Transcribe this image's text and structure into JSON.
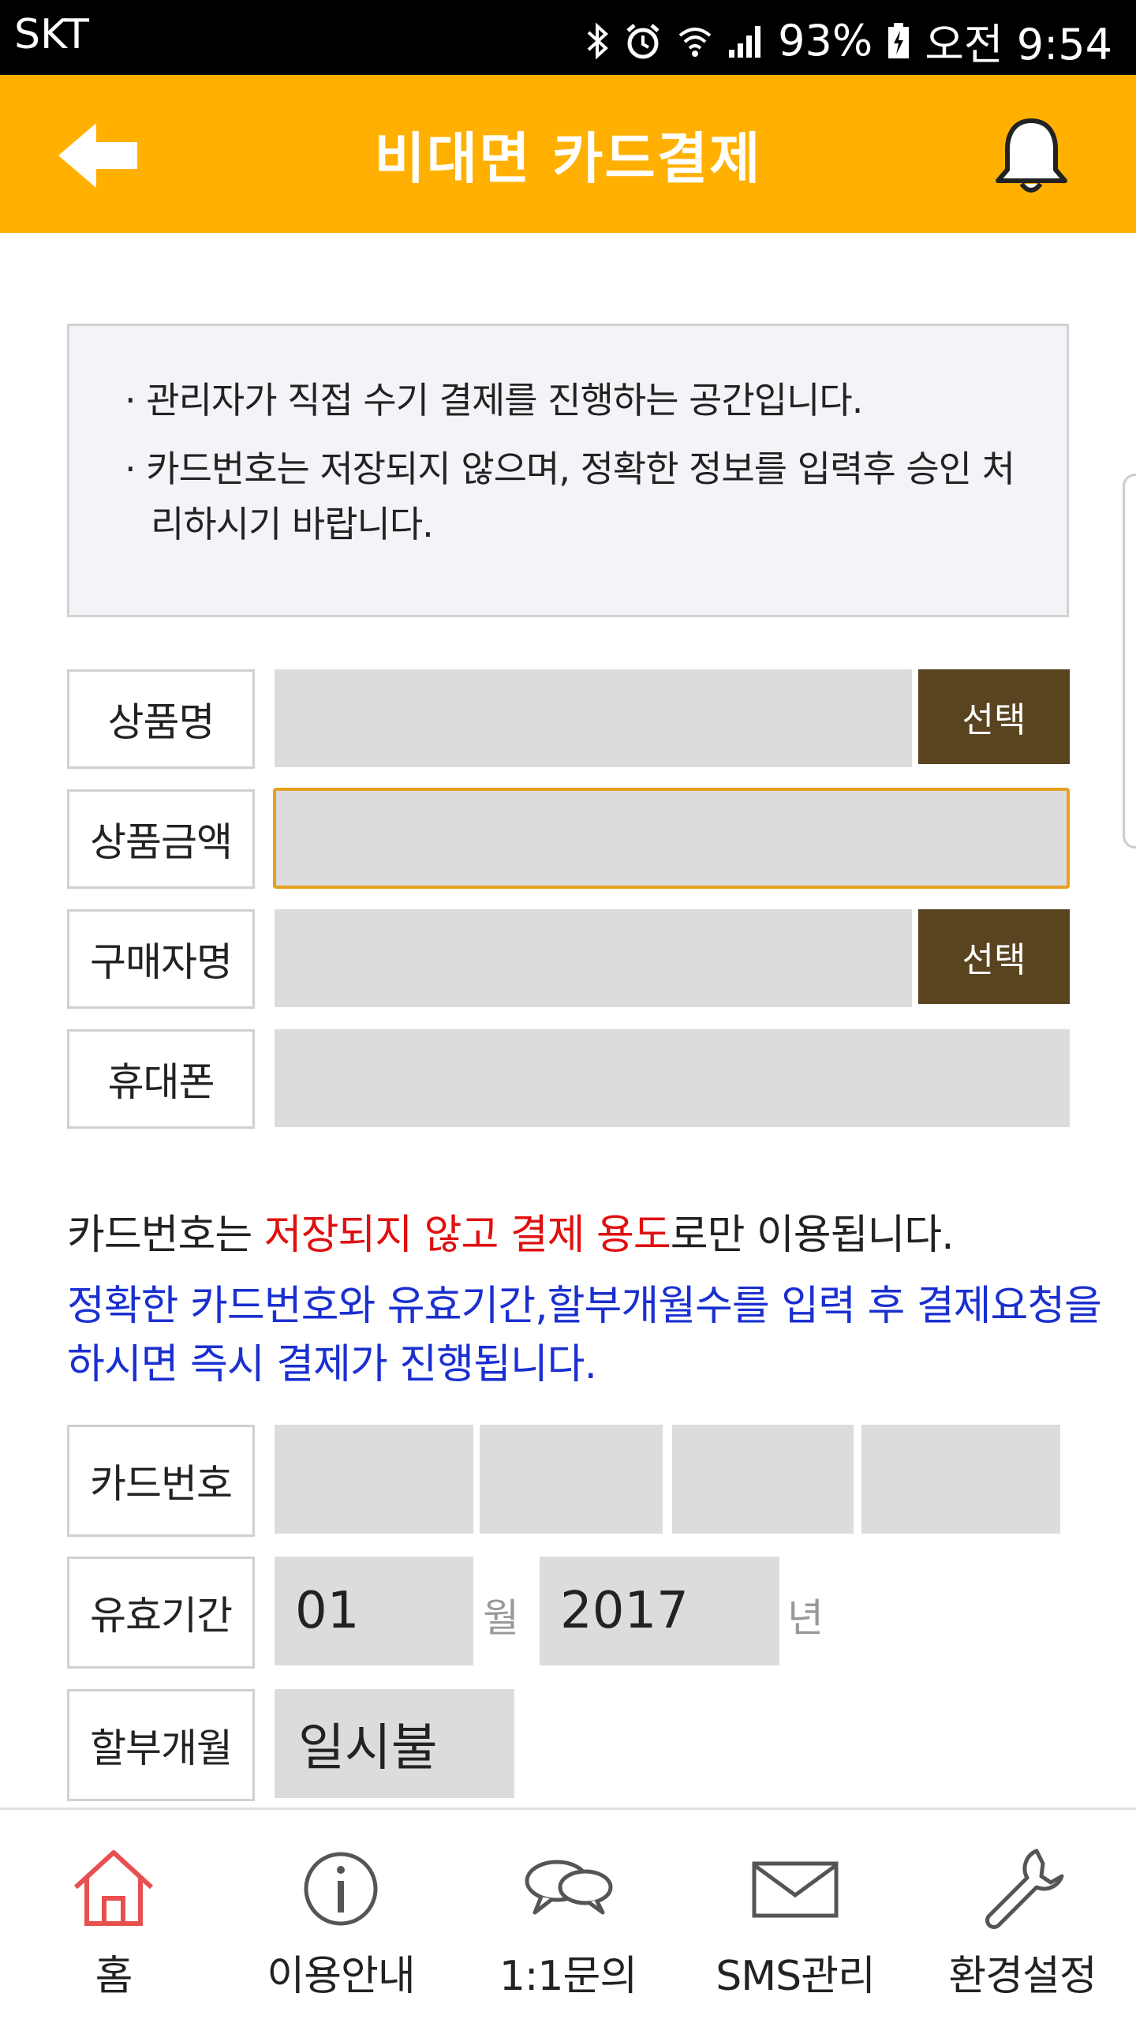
{
  "status_bar": {
    "carrier": "SKT",
    "battery": "93%",
    "time": "오전 9:54"
  },
  "header": {
    "title": "비대면 카드결제",
    "back_icon": "arrow-left-icon",
    "bell_icon": "bell-icon",
    "color": "#ffb000"
  },
  "notice": {
    "line1": "· 관리자가 직접 수기 결제를 진행하는 공간입니다.",
    "line2": "· 카드번호는 저장되지 않으며, 정확한 정보를 입력후 승인 처",
    "line3": "리하시기 바랍니다."
  },
  "form": {
    "product_name_label": "상품명",
    "product_name_value": "",
    "product_price_label": "상품금액",
    "product_price_value": "",
    "buyer_name_label": "구매자명",
    "buyer_name_value": "",
    "phone_label": "휴대폰",
    "phone_value": "",
    "select_label": "선택",
    "select_color": "#5a4420"
  },
  "card_info": {
    "line1_prefix": "카드번호는 ",
    "line1_highlight": "저장되지 않고 결제 용도",
    "line1_suffix": "로만 이용됩니다.",
    "line2": "정확한 카드번호와 유효기간,할부개월수를 입력 후 결제요청을",
    "line3": "하시면 즉시 결제가 진행됩니다.",
    "highlight_color": "#e01010",
    "blue_color": "#1a2fd0"
  },
  "card_form": {
    "card_number_label": "카드번호",
    "card_number_parts": [
      "",
      "",
      "",
      ""
    ],
    "expiry_label": "유효기간",
    "expiry_month": "01",
    "month_unit": "월",
    "expiry_year": "2017",
    "year_unit": "년",
    "installment_label": "할부개월",
    "installment_value": "일시불"
  },
  "bottom_nav": {
    "items": [
      {
        "label": "홈",
        "icon": "home-icon",
        "active": true
      },
      {
        "label": "이용안내",
        "icon": "info-icon"
      },
      {
        "label": "1:1문의",
        "icon": "chat-icon"
      },
      {
        "label": "SMS관리",
        "icon": "mail-icon"
      },
      {
        "label": "환경설정",
        "icon": "wrench-icon"
      }
    ],
    "active_color": "#e85050"
  }
}
